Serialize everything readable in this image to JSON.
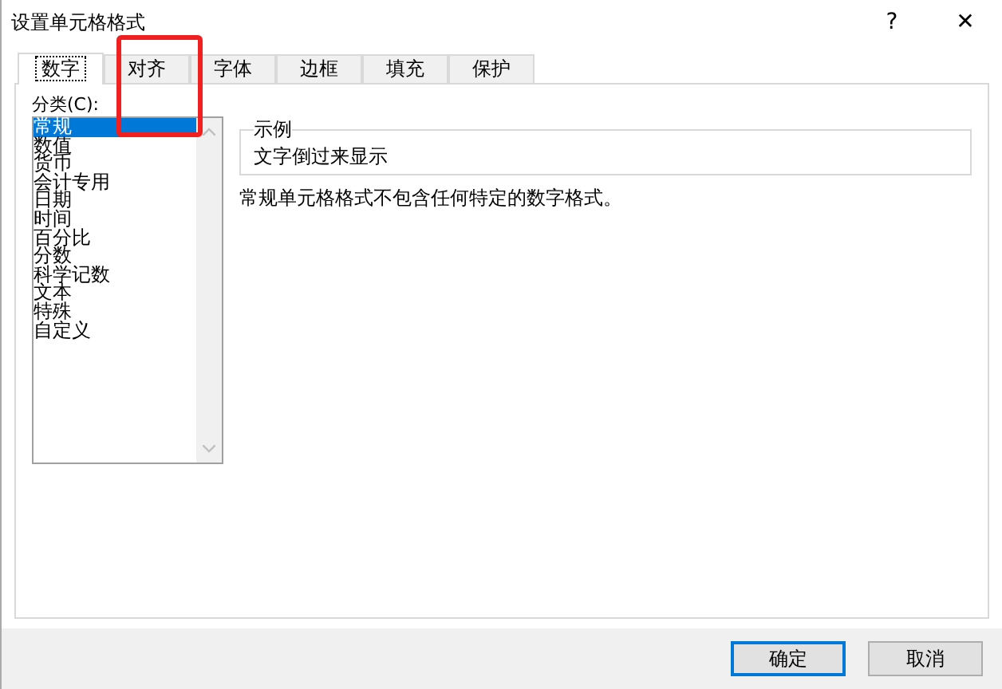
{
  "window": {
    "title": "设置单元格格式",
    "help": "?",
    "close": "✕"
  },
  "tabs": [
    {
      "label": "数字",
      "selected": true
    },
    {
      "label": "对齐",
      "selected": false,
      "annotated": true
    },
    {
      "label": "字体",
      "selected": false
    },
    {
      "label": "边框",
      "selected": false
    },
    {
      "label": "填充",
      "selected": false
    },
    {
      "label": "保护",
      "selected": false
    }
  ],
  "category": {
    "label": "分类(C):",
    "items": [
      {
        "label": "常规",
        "selected": true
      },
      {
        "label": "数值",
        "selected": false
      },
      {
        "label": "货币",
        "selected": false
      },
      {
        "label": "会计专用",
        "selected": false
      },
      {
        "label": "日期",
        "selected": false
      },
      {
        "label": "时间",
        "selected": false
      },
      {
        "label": "百分比",
        "selected": false
      },
      {
        "label": "分数",
        "selected": false
      },
      {
        "label": "科学记数",
        "selected": false
      },
      {
        "label": "文本",
        "selected": false
      },
      {
        "label": "特殊",
        "selected": false
      },
      {
        "label": "自定义",
        "selected": false
      }
    ]
  },
  "sample": {
    "label": "示例",
    "value": "文字倒过来显示"
  },
  "description": "常规单元格格式不包含任何特定的数字格式。",
  "buttons": [
    {
      "label": "确定",
      "focused": true
    },
    {
      "label": "取消",
      "focused": false
    }
  ],
  "annotation": {
    "kind": "frame",
    "color": "#f02020"
  }
}
